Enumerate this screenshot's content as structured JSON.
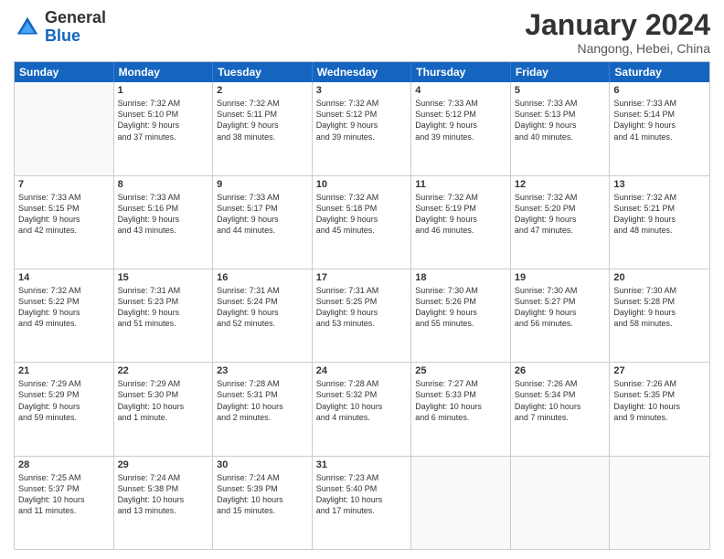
{
  "header": {
    "logo_general": "General",
    "logo_blue": "Blue",
    "month_title": "January 2024",
    "subtitle": "Nangong, Hebei, China"
  },
  "calendar": {
    "days": [
      "Sunday",
      "Monday",
      "Tuesday",
      "Wednesday",
      "Thursday",
      "Friday",
      "Saturday"
    ],
    "rows": [
      [
        {
          "day": "",
          "empty": true
        },
        {
          "day": "1",
          "lines": [
            "Sunrise: 7:32 AM",
            "Sunset: 5:10 PM",
            "Daylight: 9 hours",
            "and 37 minutes."
          ]
        },
        {
          "day": "2",
          "lines": [
            "Sunrise: 7:32 AM",
            "Sunset: 5:11 PM",
            "Daylight: 9 hours",
            "and 38 minutes."
          ]
        },
        {
          "day": "3",
          "lines": [
            "Sunrise: 7:32 AM",
            "Sunset: 5:12 PM",
            "Daylight: 9 hours",
            "and 39 minutes."
          ]
        },
        {
          "day": "4",
          "lines": [
            "Sunrise: 7:33 AM",
            "Sunset: 5:12 PM",
            "Daylight: 9 hours",
            "and 39 minutes."
          ]
        },
        {
          "day": "5",
          "lines": [
            "Sunrise: 7:33 AM",
            "Sunset: 5:13 PM",
            "Daylight: 9 hours",
            "and 40 minutes."
          ]
        },
        {
          "day": "6",
          "lines": [
            "Sunrise: 7:33 AM",
            "Sunset: 5:14 PM",
            "Daylight: 9 hours",
            "and 41 minutes."
          ]
        }
      ],
      [
        {
          "day": "7",
          "lines": [
            "Sunrise: 7:33 AM",
            "Sunset: 5:15 PM",
            "Daylight: 9 hours",
            "and 42 minutes."
          ]
        },
        {
          "day": "8",
          "lines": [
            "Sunrise: 7:33 AM",
            "Sunset: 5:16 PM",
            "Daylight: 9 hours",
            "and 43 minutes."
          ]
        },
        {
          "day": "9",
          "lines": [
            "Sunrise: 7:33 AM",
            "Sunset: 5:17 PM",
            "Daylight: 9 hours",
            "and 44 minutes."
          ]
        },
        {
          "day": "10",
          "lines": [
            "Sunrise: 7:32 AM",
            "Sunset: 5:18 PM",
            "Daylight: 9 hours",
            "and 45 minutes."
          ]
        },
        {
          "day": "11",
          "lines": [
            "Sunrise: 7:32 AM",
            "Sunset: 5:19 PM",
            "Daylight: 9 hours",
            "and 46 minutes."
          ]
        },
        {
          "day": "12",
          "lines": [
            "Sunrise: 7:32 AM",
            "Sunset: 5:20 PM",
            "Daylight: 9 hours",
            "and 47 minutes."
          ]
        },
        {
          "day": "13",
          "lines": [
            "Sunrise: 7:32 AM",
            "Sunset: 5:21 PM",
            "Daylight: 9 hours",
            "and 48 minutes."
          ]
        }
      ],
      [
        {
          "day": "14",
          "lines": [
            "Sunrise: 7:32 AM",
            "Sunset: 5:22 PM",
            "Daylight: 9 hours",
            "and 49 minutes."
          ]
        },
        {
          "day": "15",
          "lines": [
            "Sunrise: 7:31 AM",
            "Sunset: 5:23 PM",
            "Daylight: 9 hours",
            "and 51 minutes."
          ]
        },
        {
          "day": "16",
          "lines": [
            "Sunrise: 7:31 AM",
            "Sunset: 5:24 PM",
            "Daylight: 9 hours",
            "and 52 minutes."
          ]
        },
        {
          "day": "17",
          "lines": [
            "Sunrise: 7:31 AM",
            "Sunset: 5:25 PM",
            "Daylight: 9 hours",
            "and 53 minutes."
          ]
        },
        {
          "day": "18",
          "lines": [
            "Sunrise: 7:30 AM",
            "Sunset: 5:26 PM",
            "Daylight: 9 hours",
            "and 55 minutes."
          ]
        },
        {
          "day": "19",
          "lines": [
            "Sunrise: 7:30 AM",
            "Sunset: 5:27 PM",
            "Daylight: 9 hours",
            "and 56 minutes."
          ]
        },
        {
          "day": "20",
          "lines": [
            "Sunrise: 7:30 AM",
            "Sunset: 5:28 PM",
            "Daylight: 9 hours",
            "and 58 minutes."
          ]
        }
      ],
      [
        {
          "day": "21",
          "lines": [
            "Sunrise: 7:29 AM",
            "Sunset: 5:29 PM",
            "Daylight: 9 hours",
            "and 59 minutes."
          ]
        },
        {
          "day": "22",
          "lines": [
            "Sunrise: 7:29 AM",
            "Sunset: 5:30 PM",
            "Daylight: 10 hours",
            "and 1 minute."
          ]
        },
        {
          "day": "23",
          "lines": [
            "Sunrise: 7:28 AM",
            "Sunset: 5:31 PM",
            "Daylight: 10 hours",
            "and 2 minutes."
          ]
        },
        {
          "day": "24",
          "lines": [
            "Sunrise: 7:28 AM",
            "Sunset: 5:32 PM",
            "Daylight: 10 hours",
            "and 4 minutes."
          ]
        },
        {
          "day": "25",
          "lines": [
            "Sunrise: 7:27 AM",
            "Sunset: 5:33 PM",
            "Daylight: 10 hours",
            "and 6 minutes."
          ]
        },
        {
          "day": "26",
          "lines": [
            "Sunrise: 7:26 AM",
            "Sunset: 5:34 PM",
            "Daylight: 10 hours",
            "and 7 minutes."
          ]
        },
        {
          "day": "27",
          "lines": [
            "Sunrise: 7:26 AM",
            "Sunset: 5:35 PM",
            "Daylight: 10 hours",
            "and 9 minutes."
          ]
        }
      ],
      [
        {
          "day": "28",
          "lines": [
            "Sunrise: 7:25 AM",
            "Sunset: 5:37 PM",
            "Daylight: 10 hours",
            "and 11 minutes."
          ]
        },
        {
          "day": "29",
          "lines": [
            "Sunrise: 7:24 AM",
            "Sunset: 5:38 PM",
            "Daylight: 10 hours",
            "and 13 minutes."
          ]
        },
        {
          "day": "30",
          "lines": [
            "Sunrise: 7:24 AM",
            "Sunset: 5:39 PM",
            "Daylight: 10 hours",
            "and 15 minutes."
          ]
        },
        {
          "day": "31",
          "lines": [
            "Sunrise: 7:23 AM",
            "Sunset: 5:40 PM",
            "Daylight: 10 hours",
            "and 17 minutes."
          ]
        },
        {
          "day": "",
          "empty": true
        },
        {
          "day": "",
          "empty": true
        },
        {
          "day": "",
          "empty": true
        }
      ]
    ]
  }
}
